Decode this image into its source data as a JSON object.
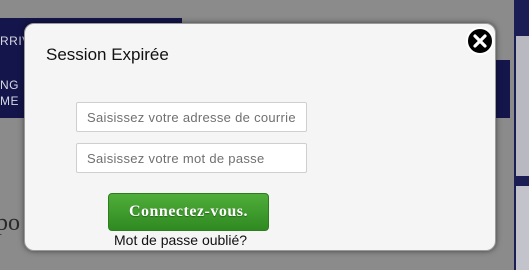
{
  "background": {
    "nav_text_1": "RRIV",
    "nav_text_2": "NG",
    "nav_text_3": "ME",
    "partial_text": "po"
  },
  "modal": {
    "title": "Session Expirée",
    "email_placeholder": "Saisissez votre adresse de courriel",
    "password_placeholder": "Saisissez votre mot de passe",
    "login_label": "Connectez-vous.",
    "forgot_label": "Mot de passe oublié?",
    "close_icon": "close-circle-icon"
  },
  "colors": {
    "overlay": "#8b8b8b",
    "nav": "#14154a",
    "modal_bg": "#f5f5f5",
    "button_green": "#3c9a2c"
  }
}
